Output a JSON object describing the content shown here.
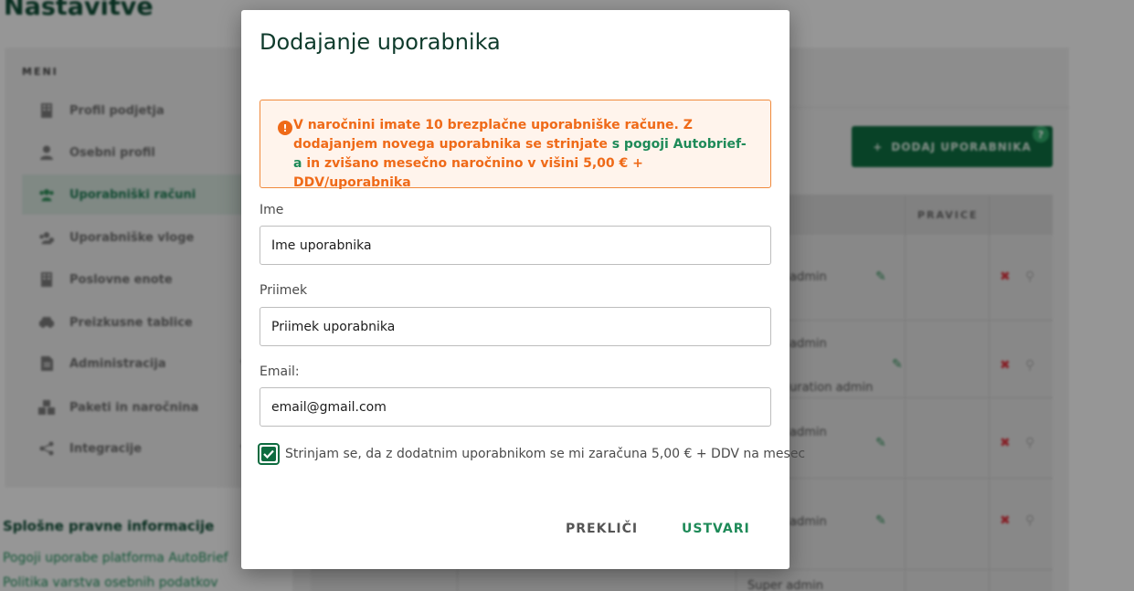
{
  "page": {
    "title": "Nastavitve",
    "menu_heading": "MENI",
    "menu_items": [
      {
        "label": "Profil podjetja",
        "icon": "building-icon"
      },
      {
        "label": "Osebni profil",
        "icon": "user-icon"
      },
      {
        "label": "Uporabniški računi",
        "icon": "users-icon"
      },
      {
        "label": "Uporabniške vloge",
        "icon": "user-roles-icon"
      },
      {
        "label": "Poslovne enote",
        "icon": "building-icon"
      },
      {
        "label": "Preizkusne tablice",
        "icon": "car-icon"
      },
      {
        "label": "Administracija",
        "icon": "document-icon"
      },
      {
        "label": "Paketi in naročnina",
        "icon": "packages-icon"
      },
      {
        "label": "Integracije",
        "icon": "share-icon"
      }
    ],
    "legal": {
      "title": "Splošne pravne informacije",
      "links": [
        "Pogoji uporabe platforma AutoBrief",
        "Politika varstva osebnih podatkov"
      ]
    },
    "add_user_button": "DODAJ UPORABNIKA",
    "help_badge": "?",
    "table_headers": {
      "pravice": "PRAVICE"
    },
    "table_cells": [
      "admin",
      "admin",
      "uration admin",
      "admin",
      "admin",
      "Super admin"
    ]
  },
  "modal": {
    "title": "Dodajanje uporabnika",
    "warning": {
      "part1": "V naročnini imate 10 brezplačne uporabniške račune. Z dodajanjem novega uporabnika se strinjate ",
      "link": "s pogoji Autobrief-a",
      "part2": " in zvišano mesečno naročnino v višini 5,00 € + DDV/uporabnika"
    },
    "fields": {
      "first_name": {
        "label": "Ime",
        "value": "Ime uporabnika"
      },
      "last_name": {
        "label": "Priimek",
        "value": "Priimek uporabnika"
      },
      "email": {
        "label": "Email:",
        "value": "email@gmail.com"
      }
    },
    "consent": {
      "checked": true,
      "label": "Strinjam se, da z dodatnim uporabnikom se mi zaračuna 5,00 € + DDV na mesec"
    },
    "cancel_label": "PREKLIČI",
    "create_label": "USTVARI"
  },
  "colors": {
    "primary": "#0d6b3f",
    "accent": "#1e8a58",
    "warning": "#ef6a18"
  }
}
